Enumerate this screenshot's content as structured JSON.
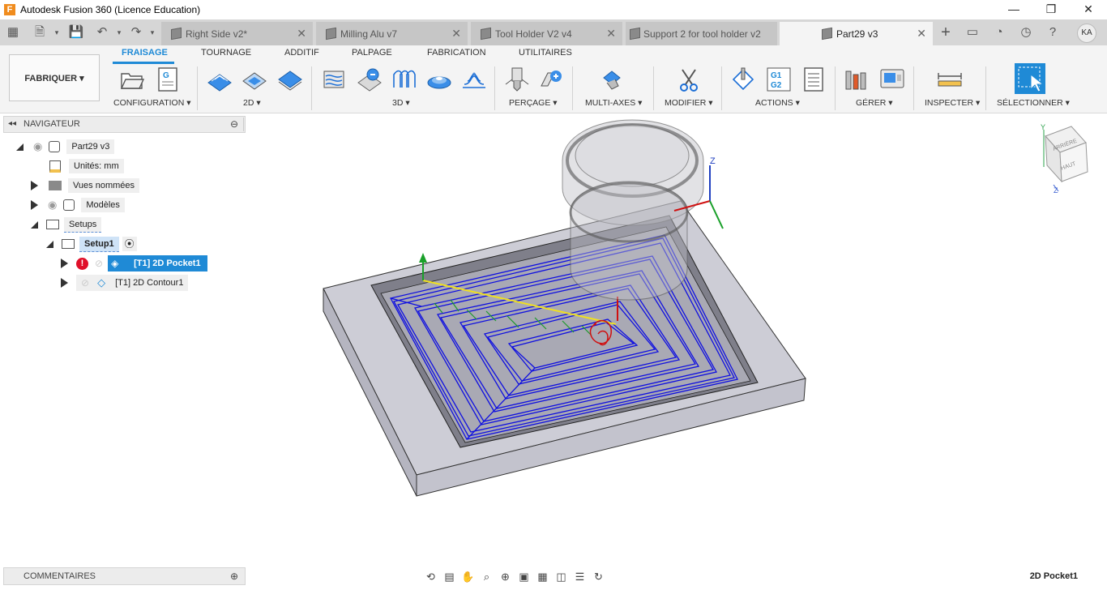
{
  "window": {
    "title": "Autodesk Fusion 360 (Licence Education)",
    "minimize": "—",
    "maximize": "❐",
    "close": "✕",
    "logo": "F"
  },
  "tabs": [
    {
      "label": "Right Side v2*",
      "active": false
    },
    {
      "label": "Milling Alu v7",
      "active": false
    },
    {
      "label": "Tool Holder V2 v4",
      "active": false
    },
    {
      "label": "Support 2 for tool holder v2",
      "active": false
    },
    {
      "label": "Part29 v3",
      "active": true
    }
  ],
  "user_initials": "KA",
  "workspace": "FABRIQUER ▾",
  "ribbon_tabs": [
    "FRAISAGE",
    "TOURNAGE",
    "ADDITIF",
    "PALPAGE",
    "FABRICATION",
    "UTILITAIRES"
  ],
  "ribbon_groups": [
    "CONFIGURATION ▾",
    "2D ▾",
    "3D ▾",
    "PERÇAGE ▾",
    "MULTI-AXES ▾",
    "MODIFIER ▾",
    "ACTIONS ▾",
    "GÉRER ▾",
    "INSPECTER ▾",
    "SÉLECTIONNER ▾"
  ],
  "navigator": {
    "title": "NAVIGATEUR",
    "root": "Part29 v3",
    "units": "Unités: mm",
    "named_views": "Vues nommées",
    "models": "Modèles",
    "setups": "Setups",
    "setup1": "Setup1",
    "op1": "[T1] 2D Pocket1",
    "op2": "[T1] 2D Contour1"
  },
  "comments": "COMMENTAIRES",
  "status": "2D Pocket1",
  "viewcube": {
    "top": "HAUT",
    "right": "ARRIÈRE",
    "axis_z": "Z",
    "axis_y": "Y"
  },
  "axis_label_z": "Z",
  "colors": {
    "accent": "#1f8ad6",
    "toolpath": "#1010e0",
    "stock": "#c9c9d2",
    "warning": "#e0102a"
  }
}
